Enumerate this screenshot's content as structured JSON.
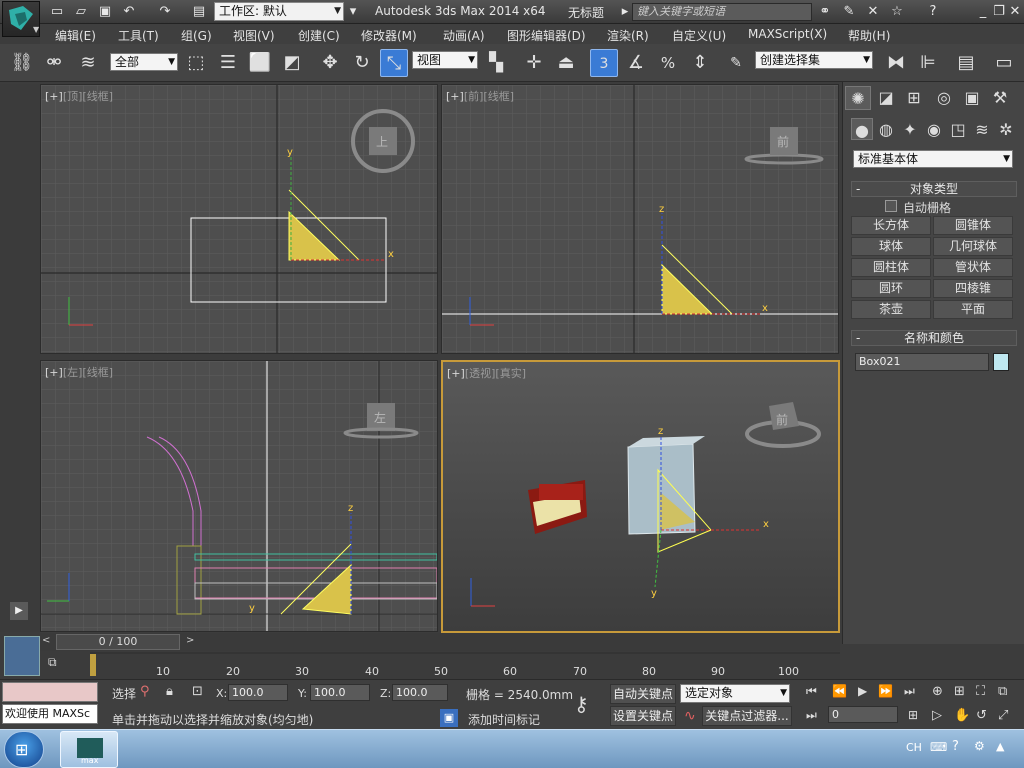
{
  "titlebar": {
    "workspace": "工作区: 默认",
    "app_title": "Autodesk 3ds Max  2014 x64",
    "doc_title": "无标题",
    "search_placeholder": "键入关键字或短语"
  },
  "menu": [
    "编辑(E)",
    "工具(T)",
    "组(G)",
    "视图(V)",
    "创建(C)",
    "修改器(M)",
    "动画(A)",
    "图形编辑器(D)",
    "渲染(R)",
    "自定义(U)",
    "MAXScript(X)",
    "帮助(H)"
  ],
  "toolbar": {
    "selection_filter": "全部",
    "ref_coord": "视图",
    "snap_label": "3",
    "named_selection": "创建选择集"
  },
  "viewports": {
    "top": {
      "plus": "[+]",
      "name": "[顶]",
      "mode": "[线框]",
      "cube_label": "上"
    },
    "front": {
      "plus": "[+]",
      "name": "[前]",
      "mode": "[线框]",
      "cube_label": "前"
    },
    "left": {
      "plus": "[+]",
      "name": "[左]",
      "mode": "[线框]",
      "cube_label": "左"
    },
    "persp": {
      "plus": "[+]",
      "name": "[透视]",
      "mode": "[真实]",
      "cube_label": "前"
    }
  },
  "axes": {
    "x": "x",
    "y": "y",
    "z": "z"
  },
  "cmdpanel": {
    "category": "标准基本体",
    "object_type_title": "对象类型",
    "autogrid_label": "自动栅格",
    "object_buttons": [
      "长方体",
      "圆锥体",
      "球体",
      "几何球体",
      "圆柱体",
      "管状体",
      "圆环",
      "四棱锥",
      "茶壶",
      "平面"
    ],
    "name_color_title": "名称和颜色",
    "object_name": "Box021",
    "object_color": "#bfe8f0"
  },
  "timeline": {
    "frame_display": "0 / 100",
    "ticks": [
      "10",
      "20",
      "30",
      "40",
      "50",
      "60",
      "70",
      "80",
      "90",
      "100"
    ]
  },
  "status": {
    "maxscript_listener": "欢迎使用 MAXSc",
    "select_label": "选择",
    "x_label": "X:",
    "x_value": "100.0",
    "y_label": "Y:",
    "y_value": "100.0",
    "z_label": "Z:",
    "z_value": "100.0",
    "grid_text": "栅格 = 2540.0mm",
    "auto_key": "自动关键点",
    "set_key": "设置关键点",
    "key_target": "选定对象",
    "key_filters": "关键点过滤器...",
    "frame_value": "0",
    "prompt": "单击并拖动以选择并缩放对象(均匀地)",
    "add_time_tag": "添加时间标记"
  },
  "taskbar": {
    "lang": "CH",
    "max_label": "max"
  }
}
